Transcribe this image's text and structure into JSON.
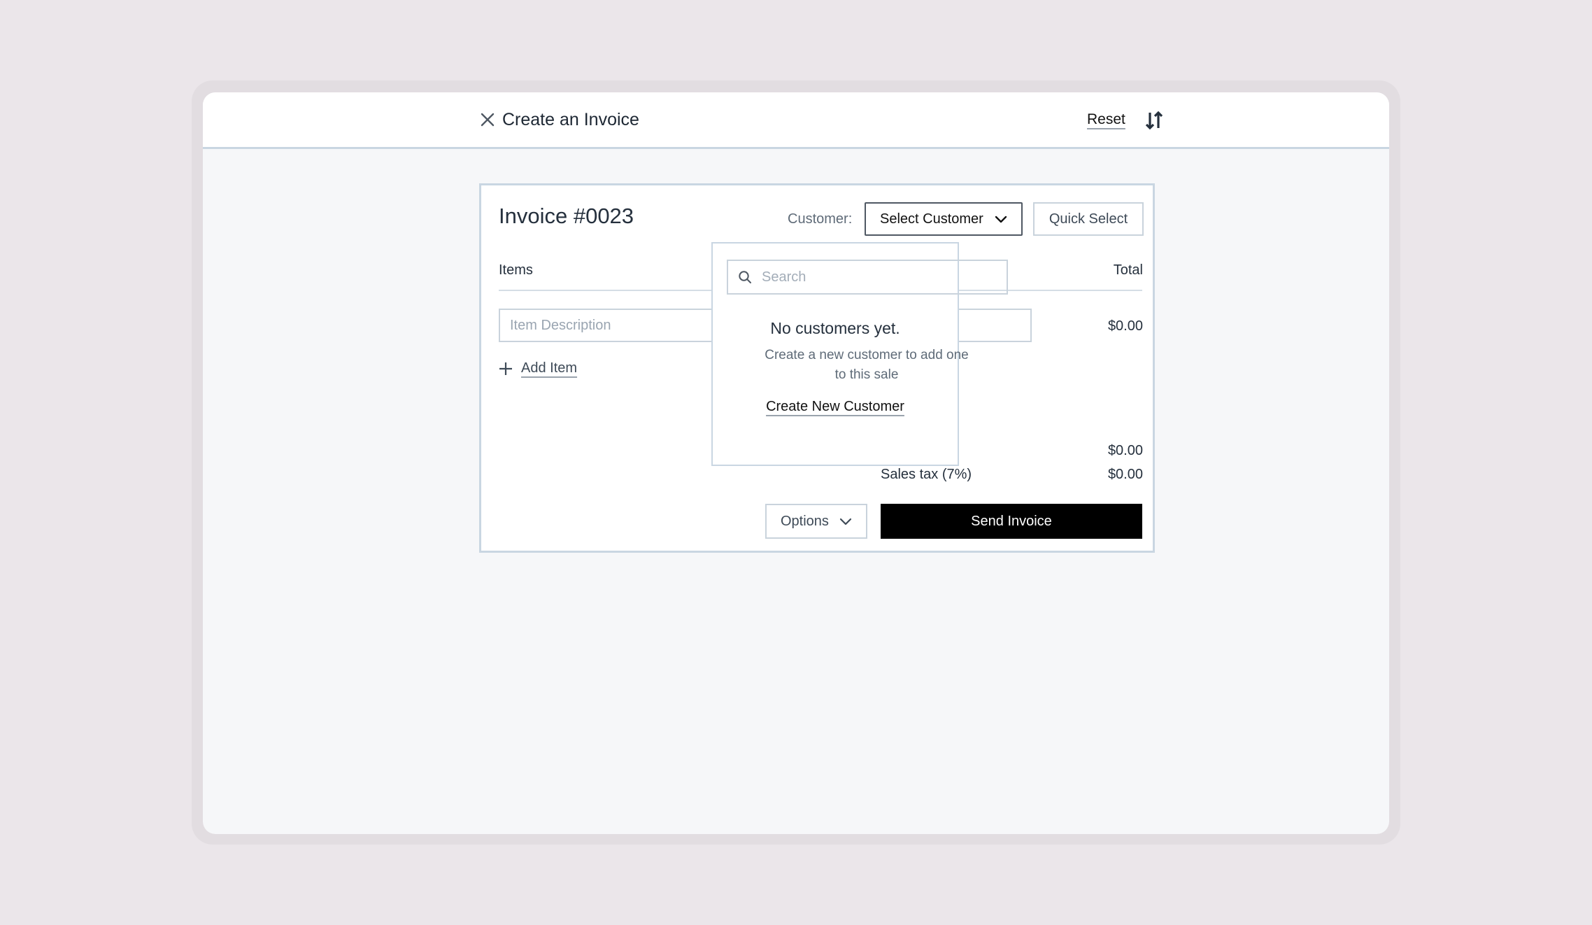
{
  "header": {
    "title": "Create an Invoice",
    "reset_label": "Reset",
    "close_icon": "close-icon",
    "sort_icon": "sort-icon"
  },
  "invoice": {
    "title": "Invoice #0023",
    "customer_label": "Customer:",
    "select_customer_label": "Select Customer",
    "quick_select_label": "Quick Select",
    "items_header": "Items",
    "total_header": "Total",
    "item_description_placeholder": "Item Description",
    "line_total": "$0.00",
    "add_item_label": "Add Item",
    "subtotal": "$0.00",
    "sales_tax_label": "Sales tax (7%)",
    "sales_tax_value": "$0.00",
    "options_label": "Options",
    "send_label": "Send Invoice"
  },
  "customer_dropdown": {
    "search_placeholder": "Search",
    "empty_title": "No customers yet.",
    "empty_description": "Create a new customer to add one to this sale",
    "create_link": "Create New Customer"
  },
  "colors": {
    "background": "#ebe6ea",
    "surface": "#ffffff",
    "border": "#c9d6e2",
    "primary_button": "#000000",
    "text": "#1d2733"
  }
}
